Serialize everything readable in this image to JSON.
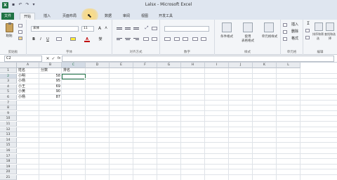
{
  "window": {
    "title": "Lalsx - Microsoft Excel"
  },
  "qat": [
    "save-icon",
    "undo-icon",
    "redo-icon",
    "customize-icon"
  ],
  "tabs": [
    {
      "label": "文件"
    },
    {
      "label": "开始"
    },
    {
      "label": "插入"
    },
    {
      "label": "页面布局"
    },
    {
      "label": ""
    },
    {
      "label": "数据"
    },
    {
      "label": "审阅"
    },
    {
      "label": "视图"
    },
    {
      "label": "开发工具"
    }
  ],
  "ribbon": {
    "clipboard": {
      "paste_label": "粘贴",
      "group_label": "剪贴板"
    },
    "font": {
      "name": "宋体",
      "size": "11",
      "grow": "A",
      "shrink": "A",
      "bold": "B",
      "italic": "I",
      "underline": "U",
      "font_color_glyph": "A",
      "phonetic": "燮",
      "group_label": "字体"
    },
    "alignment": {
      "group_label": "对齐方式"
    },
    "number": {
      "group_label": "数字",
      "format_value": ""
    },
    "styles": {
      "cond_format": "条件格式",
      "table_format": "套用\n表格格式",
      "cell_styles": "单元格样式",
      "group_label": "样式"
    },
    "cells": {
      "insert": "插入",
      "delete": "删除",
      "format": "格式",
      "group_label": "单元格"
    },
    "editing": {
      "sort": "排序和筛选",
      "find": "查找和选择",
      "group_label": "编辑"
    }
  },
  "formula_bar": {
    "name_box": "C2",
    "cancel": "✕",
    "enter": "✓",
    "fx": "fx",
    "value": ""
  },
  "sheet": {
    "columns": [
      "A",
      "B",
      "C",
      "D",
      "E",
      "F",
      "G",
      "H",
      "I",
      "J",
      "K",
      "L"
    ],
    "rows": [
      "1",
      "2",
      "3",
      "4",
      "5",
      "6",
      "7",
      "8",
      "9",
      "10",
      "11",
      "12",
      "13",
      "14",
      "15",
      "16",
      "17",
      "18",
      "19",
      "20",
      "21"
    ],
    "cells": {
      "A1": "姓名",
      "B1": "分数",
      "C1": "排名",
      "A2": "小明",
      "B2": "58",
      "A3": "小杨",
      "B3": "95",
      "A4": "小王",
      "B4": "69",
      "A5": "小黄",
      "B5": "90",
      "A6": "小杨",
      "B6": "87"
    },
    "selected": "C2"
  }
}
